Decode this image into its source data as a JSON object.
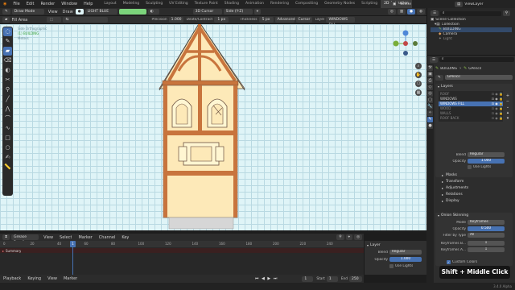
{
  "menubar": {
    "items": [
      "File",
      "Edit",
      "Render",
      "Window",
      "Help"
    ],
    "workspaces": [
      "Layout",
      "Modeling",
      "Sculpting",
      "UV Editing",
      "Texture Paint",
      "Shading",
      "Animation",
      "Rendering",
      "Compositing",
      "Geometry Nodes",
      "Scripting",
      "2D Animation"
    ],
    "active_workspace": "2D Animation",
    "scene": "Scene",
    "view_layer": "ViewLayer"
  },
  "viewport_header": {
    "mode": "Draw Mode",
    "view": "View",
    "draw": "Draw",
    "material": "LIGHT BLUE",
    "cursor": "3D Cursor",
    "side": "Side (Y-Z)"
  },
  "tool_settings": {
    "tool": "Fill Area",
    "precision_label": "Precision",
    "precision_value": "1.000",
    "dilate_label": "Dilate/Contract",
    "dilate_value": "1 px",
    "thickness_label": "Thickness",
    "thickness_value": "5 px",
    "advanced": "Advanced",
    "cursor": "Cursor",
    "layer_label": "Layer",
    "layer_value": "WINDOWS FILL"
  },
  "viewport_info": {
    "line1": "Side Orthographic",
    "line2": "(1) BUILDING",
    "line3": "Meters"
  },
  "toolbar_icons": [
    "select-box-icon",
    "draw-icon",
    "fill-icon",
    "erase-icon",
    "tint-icon",
    "cutter-icon",
    "eyedropper-icon",
    "line-icon",
    "polyline-icon",
    "arc-icon",
    "curve-icon",
    "box-icon",
    "circle-icon",
    "annotate-icon",
    "measure-icon"
  ],
  "timeline": {
    "editor": "Grease Pencil",
    "menus": [
      "View",
      "Select",
      "Marker",
      "Channel",
      "Key"
    ],
    "ruler": [
      "0",
      "20",
      "40",
      "60",
      "80",
      "100",
      "120",
      "140",
      "160",
      "180",
      "200",
      "220",
      "240"
    ],
    "current_frame": "1",
    "summary": "Summary",
    "footer": [
      "Playback",
      "Keying",
      "View",
      "Marker"
    ],
    "start_label": "Start",
    "start_value": "1",
    "end_label": "End",
    "end_value": "250"
  },
  "timeline_panel": {
    "section": "Layer",
    "blend_label": "Blend",
    "blend_value": "Regular",
    "opacity_label": "Opacity",
    "opacity_value": "1.000",
    "use_lights": "Use Lights"
  },
  "outliner": {
    "title": "Scene Collection",
    "items": [
      {
        "name": "Collection",
        "icon": "collection-icon"
      },
      {
        "name": "BUILDING",
        "icon": "grease-pencil-icon"
      },
      {
        "name": "Camera",
        "icon": "camera-icon"
      },
      {
        "name": "Light",
        "icon": "light-icon"
      }
    ]
  },
  "properties": {
    "object": "BUILDING",
    "data": "GPencil",
    "layers_title": "Layers",
    "layers": [
      "ROOF",
      "WINDOWS",
      "WINDOWS FILL",
      "WOOD",
      "WALLS",
      "ROOF BACK"
    ],
    "active_layer": "WINDOWS FILL",
    "blend_label": "Blend",
    "blend_value": "Regular",
    "opacity_label": "Opacity",
    "opacity_value": "1.000",
    "use_lights": "Use Lights",
    "sections": [
      "Masks",
      "Transform",
      "Adjustments",
      "Relations",
      "Display"
    ],
    "onion_title": "Onion Skinning",
    "mode_label": "Mode",
    "mode_value": "Keyframes",
    "onion_opacity_label": "Opacity",
    "onion_opacity_value": "0.500",
    "filter_label": "Filter by Type",
    "filter_value": "All",
    "kf_before_label": "Keyframes B...",
    "kf_before_value": "1",
    "kf_after_label": "Keyframes A...",
    "kf_after_value": "1",
    "custom_colors": "Custom Colors"
  },
  "hint": "Shift + Middle Click",
  "version": "3.4.0 Alpha",
  "colors": {
    "accent": "#4772b3",
    "wood": "#c8743d",
    "wall": "#fde9b8",
    "window": "#fff6d2",
    "base": "#d6d6d6"
  }
}
